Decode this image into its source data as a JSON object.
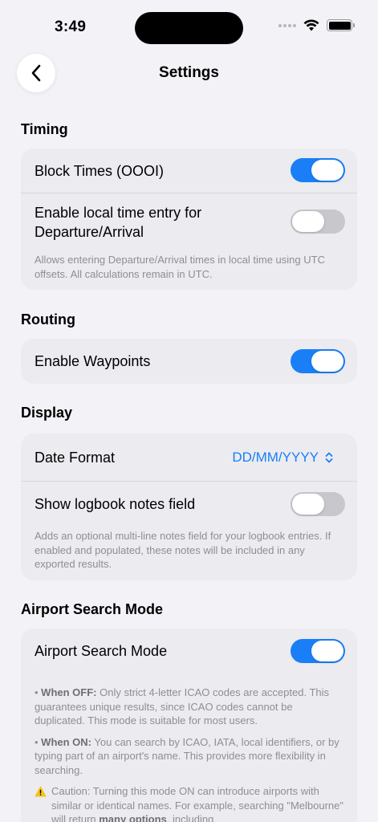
{
  "status_bar": {
    "time": "3:49"
  },
  "nav": {
    "title": "Settings"
  },
  "colors": {
    "accent": "#1a7ff6",
    "toggle_off": "#c7c7cc",
    "background": "#f2f2f7",
    "card": "#ebebf0"
  },
  "timing": {
    "header": "Timing",
    "block_times": {
      "label": "Block Times (OOOI)",
      "on": true
    },
    "local_time": {
      "label_line1": "Enable local time entry for",
      "label_line2": "Departure/Arrival",
      "on": false
    },
    "footnote": "Allows entering Departure/Arrival times in local time using UTC offsets. All calculations remain in UTC."
  },
  "routing": {
    "header": "Routing",
    "waypoints": {
      "label": "Enable Waypoints",
      "on": true
    }
  },
  "display": {
    "header": "Display",
    "date_format": {
      "label": "Date Format",
      "value": "DD/MM/YYYY"
    },
    "notes_field": {
      "label": "Show logbook notes field",
      "on": false
    },
    "footnote": "Adds an optional multi-line notes field for your logbook entries. If enabled and populated, these notes will be included in any exported results."
  },
  "airport_search": {
    "header": "Airport Search Mode",
    "toggle": {
      "label": "Airport Search Mode",
      "on": true
    },
    "off_title": "When OFF:",
    "off_text": "Only strict 4-letter ICAO codes are accepted. This guarantees unique results, since ICAO codes cannot be duplicated. This mode is suitable for most users.",
    "on_title": "When ON:",
    "on_text": "You can search by ICAO, IATA, local identifiers, or by typing part of an airport's name. This provides more flexibility in searching.",
    "caution_text": "Caution: Turning this mode ON can introduce airports with similar or identical names. For example, searching \"Melbourne\" will return",
    "caution_bold": "many options",
    "caution_tail": ", including"
  }
}
